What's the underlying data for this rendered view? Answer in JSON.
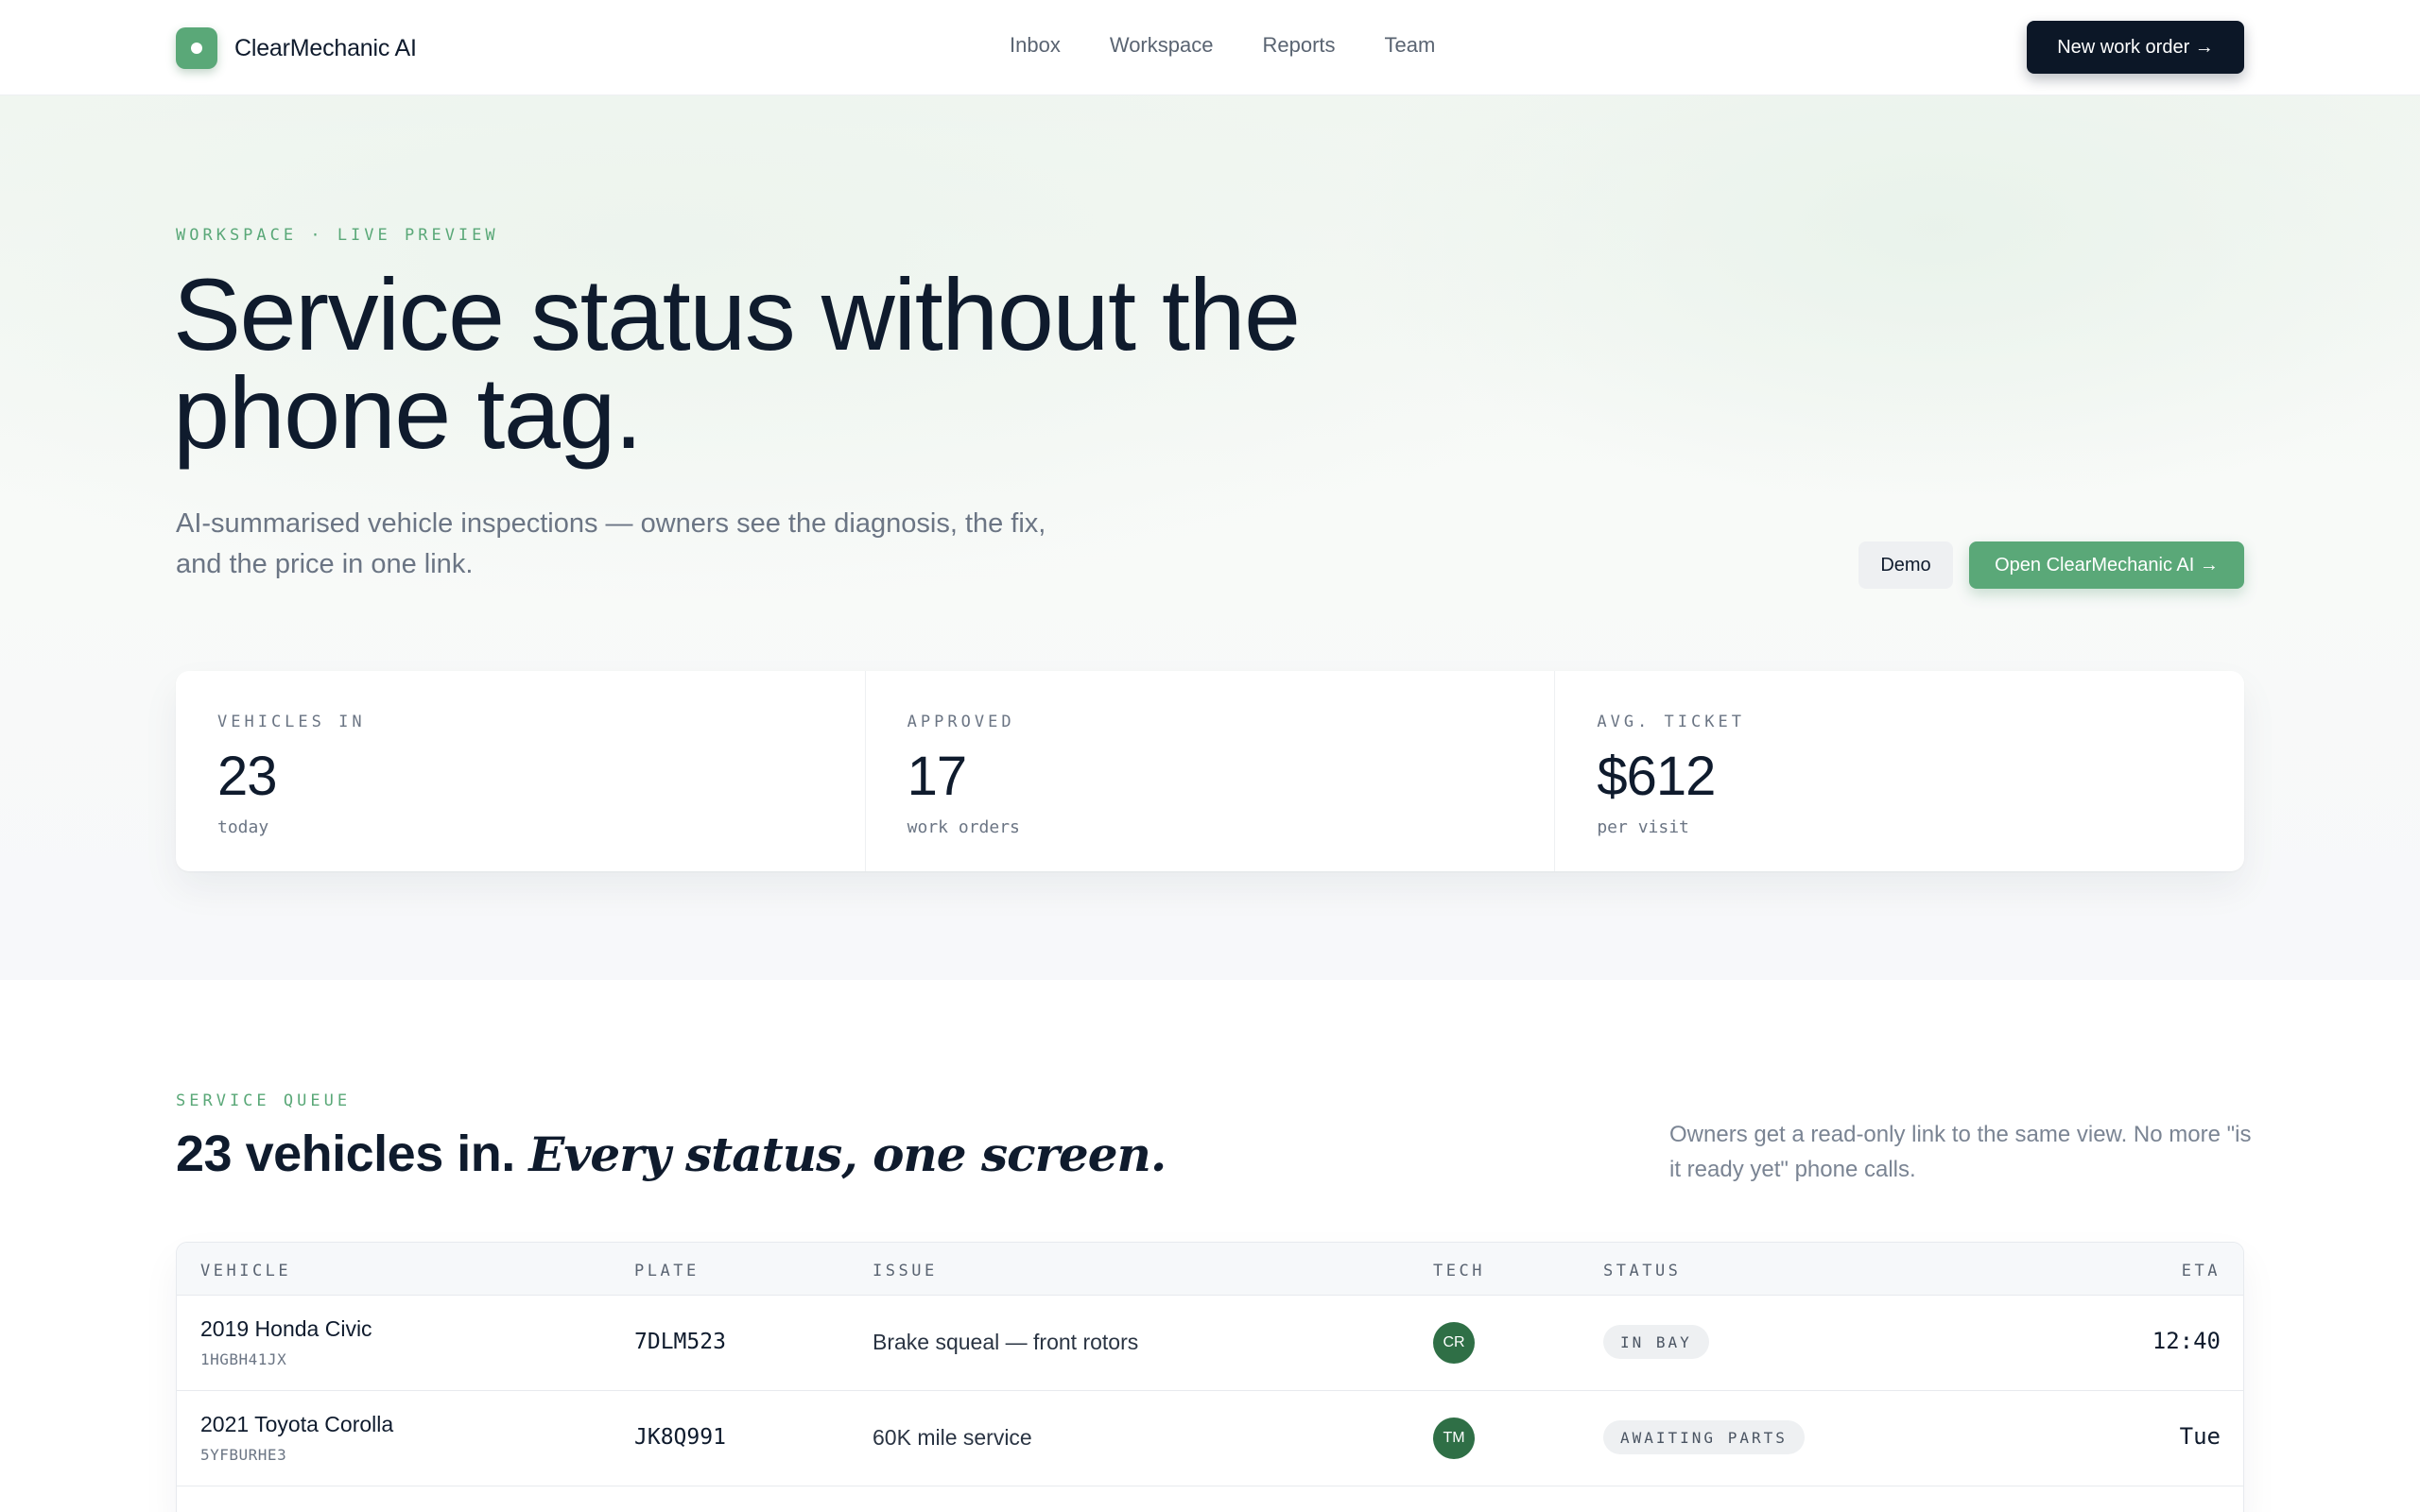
{
  "brand": {
    "name": "ClearMechanic AI"
  },
  "nav": {
    "links": [
      "Inbox",
      "Workspace",
      "Reports",
      "Team"
    ],
    "cta": "New work order →"
  },
  "hero": {
    "eyebrow": "WORKSPACE · LIVE PREVIEW",
    "title": "Service status without the phone tag.",
    "subtitle": "AI-summarised vehicle inspections — owners see the diagnosis, the fix, and the price in one link.",
    "demo_button": "Demo",
    "open_button": "Open ClearMechanic AI →"
  },
  "stats": [
    {
      "label": "VEHICLES IN",
      "value": "23",
      "unit": "today"
    },
    {
      "label": "APPROVED",
      "value": "17",
      "unit": "work orders"
    },
    {
      "label": "AVG. TICKET",
      "value": "$612",
      "unit": "per visit"
    }
  ],
  "queue": {
    "eyebrow": "SERVICE QUEUE",
    "title_main": "23 vehicles in.",
    "title_italic": "Every status, one screen.",
    "note": "Owners get a read-only link to the same view. No more \"is it ready yet\" phone calls."
  },
  "table": {
    "headers": [
      "VEHICLE",
      "PLATE",
      "ISSUE",
      "TECH",
      "STATUS",
      "ETA"
    ],
    "rows": [
      {
        "vehicle": "2019 Honda Civic",
        "vin": "1HGBH41JX",
        "plate": "7DLM523",
        "issue": "Brake squeal — front rotors",
        "tech": "CR",
        "status": "IN BAY",
        "eta": "12:40"
      },
      {
        "vehicle": "2021 Toyota Corolla",
        "vin": "5YFBURHE3",
        "plate": "JK8Q991",
        "issue": "60K mile service",
        "tech": "TM",
        "status": "AWAITING PARTS",
        "eta": "Tue"
      }
    ]
  }
}
